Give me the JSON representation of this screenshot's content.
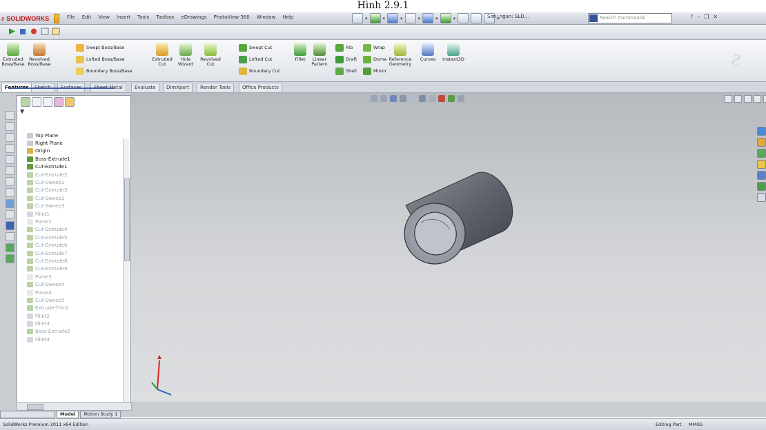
{
  "caption": "Hình 2.9.1",
  "titlebar": {
    "app_name": "SOLIDWORKS",
    "menus": [
      "File",
      "Edit",
      "View",
      "Insert",
      "Tools",
      "Toolbox",
      "eDrawings",
      "PhotoView 360",
      "Window",
      "Help"
    ],
    "document_name": "Sơn: ngan: SLD...",
    "search_placeholder": "Search Commands"
  },
  "command_manager": {
    "large_buttons": [
      {
        "label": "Extruded Boss/Base",
        "icon": "extruded-boss-icon"
      },
      {
        "label": "Revolved Boss/Base",
        "icon": "revolved-boss-icon"
      },
      {
        "label": "Extruded Cut",
        "icon": "extruded-cut-icon"
      },
      {
        "label": "Hole Wizard",
        "icon": "hole-wizard-icon"
      },
      {
        "label": "Revolved Cut",
        "icon": "revolved-cut-icon"
      },
      {
        "label": "Fillet",
        "icon": "fillet-icon"
      },
      {
        "label": "Linear Pattern",
        "icon": "linear-pattern-icon"
      },
      {
        "label": "Reference Geometry",
        "icon": "reference-geometry-icon"
      },
      {
        "label": "Curves",
        "icon": "curves-icon"
      },
      {
        "label": "Instant3D",
        "icon": "instant3d-icon"
      }
    ],
    "small_buttons": [
      {
        "label": "Swept Boss/Base"
      },
      {
        "label": "Lofted Boss/Base"
      },
      {
        "label": "Boundary Boss/Base"
      },
      {
        "label": "Swept Cut"
      },
      {
        "label": "Lofted Cut"
      },
      {
        "label": "Boundary Cut"
      },
      {
        "label": "Rib"
      },
      {
        "label": "Draft"
      },
      {
        "label": "Shell"
      },
      {
        "label": "Wrap"
      },
      {
        "label": "Dome"
      },
      {
        "label": "Mirror"
      }
    ]
  },
  "tabs": [
    "Features",
    "Sketch",
    "Surfaces",
    "Sheet Metal",
    "Evaluate",
    "DimXpert",
    "Render Tools",
    "Office Products"
  ],
  "active_tab": "Features",
  "feature_tree": [
    {
      "label": "Top Plane",
      "state": "active"
    },
    {
      "label": "Right Plane",
      "state": "active"
    },
    {
      "label": "Origin",
      "state": "active"
    },
    {
      "label": "Boss-Extrude1",
      "state": "active"
    },
    {
      "label": "Cut-Extrude1",
      "state": "active"
    },
    {
      "label": "Cut-Extrude2",
      "state": "suppressed"
    },
    {
      "label": "Cut-Sweep1",
      "state": "suppressed"
    },
    {
      "label": "Cut-Extrude3",
      "state": "suppressed"
    },
    {
      "label": "Cut-Sweep2",
      "state": "suppressed"
    },
    {
      "label": "Cut-Sweep3",
      "state": "suppressed"
    },
    {
      "label": "Fillet1",
      "state": "suppressed"
    },
    {
      "label": "Plane2",
      "state": "suppressed"
    },
    {
      "label": "Cut-Extrude4",
      "state": "suppressed"
    },
    {
      "label": "Cut-Extrude5",
      "state": "suppressed"
    },
    {
      "label": "Cut-Extrude6",
      "state": "suppressed"
    },
    {
      "label": "Cut-Extrude7",
      "state": "suppressed"
    },
    {
      "label": "Cut-Extrude8",
      "state": "suppressed"
    },
    {
      "label": "Cut-Extrude9",
      "state": "suppressed"
    },
    {
      "label": "Plane3",
      "state": "suppressed"
    },
    {
      "label": "Cut-Sweep4",
      "state": "suppressed"
    },
    {
      "label": "Plane4",
      "state": "suppressed"
    },
    {
      "label": "Cut-Sweep5",
      "state": "suppressed"
    },
    {
      "label": "Extrude-Thin2",
      "state": "suppressed"
    },
    {
      "label": "Fillet2",
      "state": "suppressed"
    },
    {
      "label": "Fillet3",
      "state": "suppressed"
    },
    {
      "label": "Boss-Extrude2",
      "state": "suppressed"
    },
    {
      "label": "Fillet4",
      "state": "suppressed"
    }
  ],
  "bottom_tabs": [
    "Model",
    "Motion Study 1"
  ],
  "status": {
    "left": "SolidWorks Premium 2011 x64 Edition",
    "mode": "Editing Part",
    "units": "MMGS"
  },
  "colors": {
    "accent": "#3a5fa8",
    "brand": "#c0161b",
    "viewport_top": "#b6b9bd",
    "viewport_bottom": "#dcdee0",
    "part_face": "#6a6f78"
  }
}
